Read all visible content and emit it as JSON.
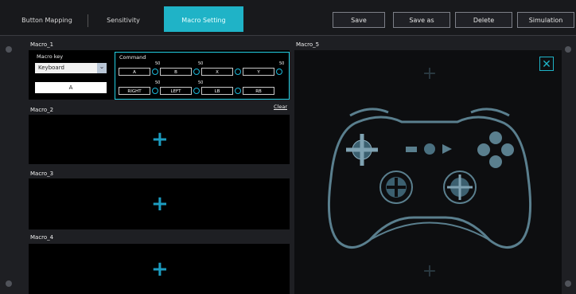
{
  "tabs": {
    "button_mapping": "Button Mapping",
    "sensitivity": "Sensitivity",
    "macro_setting": "Macro Setting"
  },
  "toolbar": {
    "save": "Save",
    "save_as": "Save as",
    "delete": "Delete",
    "simulation": "Simulation"
  },
  "macro1": {
    "title": "Macro_1",
    "macro_key_label": "Macro key",
    "key_type": "Keyboard",
    "key_value": "A",
    "command_label": "Command",
    "row1": [
      {
        "label": "A",
        "delay": "50"
      },
      {
        "label": "B",
        "delay": "50"
      },
      {
        "label": "X",
        "delay": ""
      },
      {
        "label": "Y",
        "delay": "50"
      }
    ],
    "row2": [
      {
        "label": "RIGHT",
        "delay": ""
      },
      {
        "label": "LEFT",
        "delay": "50"
      },
      {
        "label": "LB",
        "delay": "50"
      },
      {
        "label": "RB",
        "delay": ""
      }
    ],
    "clear": "Clear"
  },
  "macros": {
    "m2": "Macro_2",
    "m3": "Macro_3",
    "m4": "Macro_4",
    "m5": "Macro_5"
  },
  "icons": {
    "add": "+",
    "close": "✕",
    "dropdown": "⌄"
  },
  "colors": {
    "accent": "#1fb3c7",
    "panel": "#000000",
    "controller_outline": "#5a7f8e"
  }
}
